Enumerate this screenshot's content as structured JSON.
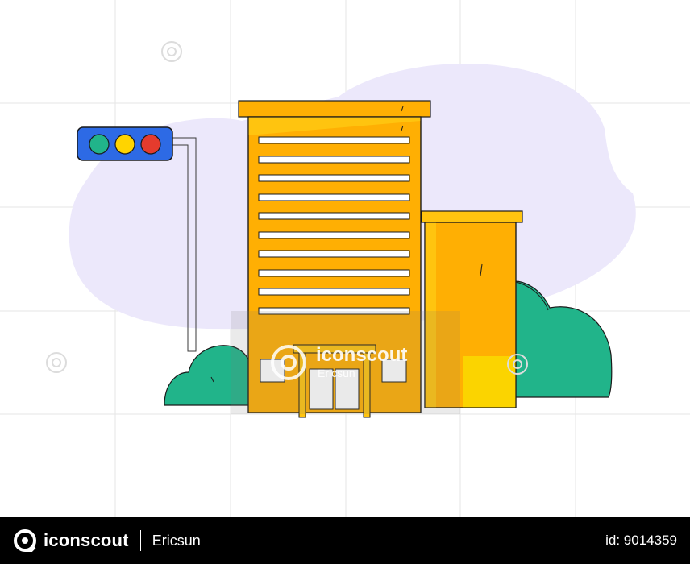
{
  "watermark": {
    "brand": "iconscout",
    "author": "Ericsun"
  },
  "footer": {
    "brand": "iconscout",
    "author": "Ericsun",
    "asset_id": "id: 9014359"
  },
  "colors": {
    "blob": "#ece8fb",
    "building_main": "#ffaf03",
    "building_highlight": "#ffc40f",
    "building_side": "#fbd400",
    "bush": "#21b48a",
    "traffic_light_body": "#2d6ae5",
    "light_green": "#21b48a",
    "light_yellow": "#ffd400",
    "light_red": "#e53b2d",
    "footer_bg": "#000000"
  }
}
